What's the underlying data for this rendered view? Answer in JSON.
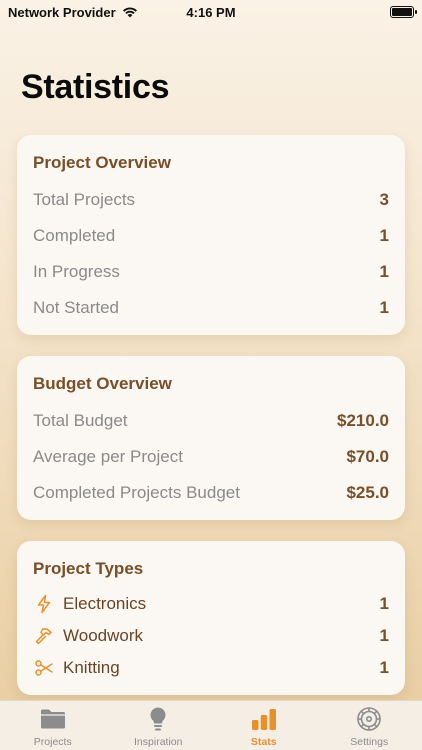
{
  "status_bar": {
    "carrier": "Network Provider",
    "time": "4:16 PM"
  },
  "page": {
    "title": "Statistics"
  },
  "project_overview": {
    "title": "Project Overview",
    "rows": [
      {
        "label": "Total Projects",
        "value": "3"
      },
      {
        "label": "Completed",
        "value": "1"
      },
      {
        "label": "In Progress",
        "value": "1"
      },
      {
        "label": "Not Started",
        "value": "1"
      }
    ]
  },
  "budget_overview": {
    "title": "Budget Overview",
    "rows": [
      {
        "label": "Total Budget",
        "value": "$210.0"
      },
      {
        "label": "Average per Project",
        "value": "$70.0"
      },
      {
        "label": "Completed Projects Budget",
        "value": "$25.0"
      }
    ]
  },
  "project_types": {
    "title": "Project Types",
    "items": [
      {
        "icon": "bolt-icon",
        "label": "Electronics",
        "value": "1"
      },
      {
        "icon": "hammer-icon",
        "label": "Woodwork",
        "value": "1"
      },
      {
        "icon": "scissors-icon",
        "label": "Knitting",
        "value": "1"
      }
    ]
  },
  "tab_bar": {
    "tabs": [
      {
        "icon": "folder-icon",
        "label": "Projects",
        "active": false
      },
      {
        "icon": "lightbulb-icon",
        "label": "Inspiration",
        "active": false
      },
      {
        "icon": "bar-chart-icon",
        "label": "Stats",
        "active": true
      },
      {
        "icon": "gear-icon",
        "label": "Settings",
        "active": false
      }
    ]
  },
  "colors": {
    "accent": "#e8912a",
    "brown_text": "#7a4e26",
    "inactive_tab": "#8c8c8c"
  }
}
